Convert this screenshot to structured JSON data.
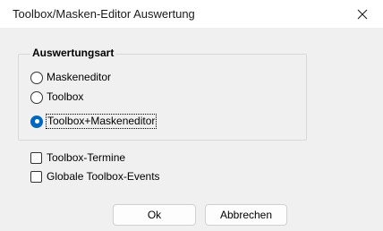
{
  "window": {
    "title": "Toolbox/Masken-Editor Auswertung",
    "close_icon": "close-icon"
  },
  "group": {
    "label": "Auswertungsart",
    "options": [
      {
        "label": "Maskeneditor",
        "selected": false
      },
      {
        "label": "Toolbox",
        "selected": false
      },
      {
        "label": "Toolbox+Maskeneditor",
        "selected": true
      }
    ]
  },
  "checkboxes": [
    {
      "label": "Toolbox-Termine",
      "checked": false
    },
    {
      "label": "Globale Toolbox-Events",
      "checked": false
    }
  ],
  "buttons": {
    "ok_label": "Ok",
    "cancel_label": "Abbrechen"
  },
  "colors": {
    "accent": "#0067c0",
    "dialog_background": "#f0f0f0",
    "titlebar_background": "#ffffff"
  }
}
